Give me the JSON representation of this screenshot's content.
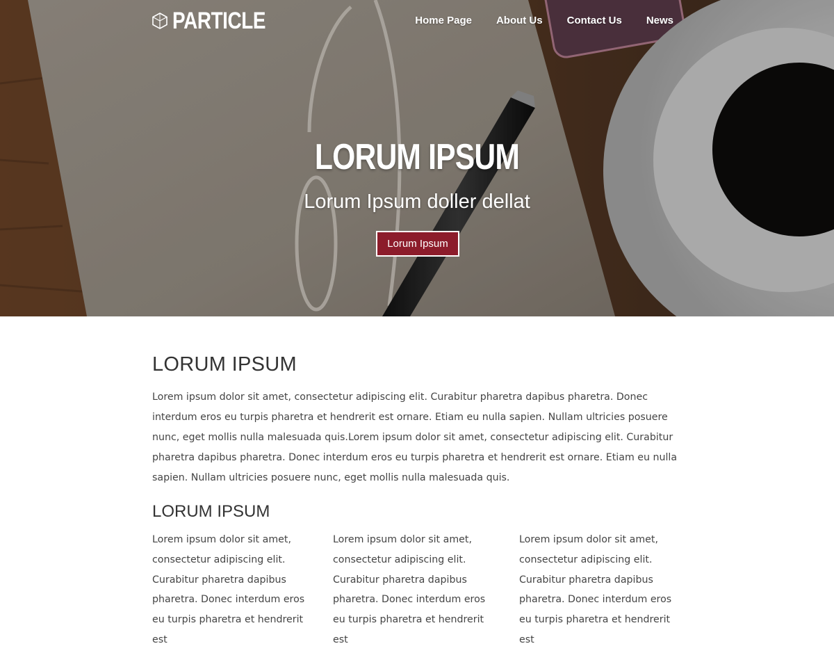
{
  "header": {
    "logo_text": "PARTICLE",
    "logo_icon": "hexagon-logo-icon",
    "nav": [
      {
        "label": "Home Page"
      },
      {
        "label": "About Us"
      },
      {
        "label": "Contact Us"
      },
      {
        "label": "News"
      }
    ]
  },
  "hero": {
    "title": "LORUM IPSUM",
    "subtitle": "Lorum Ipsum doller dellat",
    "button_label": "Lorum Ipsum",
    "button_color": "#8c1c2b"
  },
  "main": {
    "heading": "LORUM IPSUM",
    "paragraph": "Lorem ipsum dolor sit amet, consectetur adipiscing elit. Curabitur pharetra dapibus pharetra. Donec interdum eros eu turpis pharetra et hendrerit est ornare. Etiam eu nulla sapien. Nullam ultricies posuere nunc, eget mollis nulla malesuada quis.Lorem ipsum dolor sit amet, consectetur adipiscing elit. Curabitur pharetra dapibus pharetra. Donec interdum eros eu turpis pharetra et hendrerit est ornare. Etiam eu nulla sapien. Nullam ultricies posuere nunc, eget mollis nulla malesuada quis.",
    "subheading": "LORUM IPSUM",
    "columns": [
      {
        "text": "Lorem ipsum dolor sit amet, consectetur adipiscing elit. Curabitur pharetra dapibus pharetra. Donec interdum eros eu turpis pharetra et hendrerit est"
      },
      {
        "text": "Lorem ipsum dolor sit amet, consectetur adipiscing elit. Curabitur pharetra dapibus pharetra. Donec interdum eros eu turpis pharetra et hendrerit est"
      },
      {
        "text": "Lorem ipsum dolor sit amet, consectetur adipiscing elit. Curabitur pharetra dapibus pharetra. Donec interdum eros eu turpis pharetra et hendrerit est"
      }
    ]
  }
}
